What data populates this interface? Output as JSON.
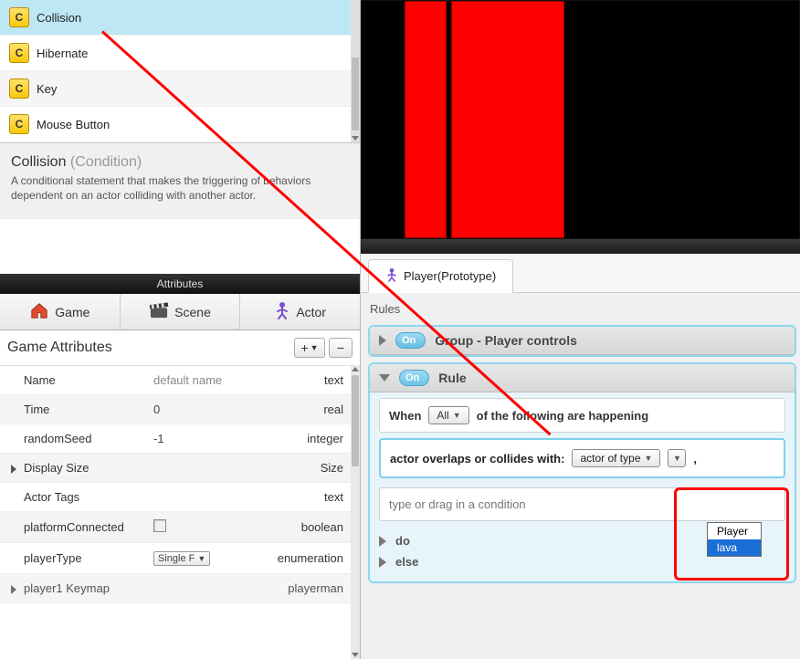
{
  "left": {
    "conditions": [
      {
        "label": "Collision",
        "selected": true
      },
      {
        "label": "Hibernate",
        "selected": false
      },
      {
        "label": "Key",
        "selected": false
      },
      {
        "label": "Mouse Button",
        "selected": false
      }
    ],
    "hint": {
      "name": "Collision",
      "type": "(Condition)",
      "body": "A conditional statement that makes the triggering of behaviors dependent on an actor colliding with another actor."
    },
    "attributes_header": "Attributes",
    "tabs": [
      "Game",
      "Scene",
      "Actor"
    ],
    "section_title": "Game Attributes",
    "table": {
      "headers": {
        "name": "Name",
        "def": "default name",
        "type": "text"
      },
      "rows": [
        {
          "name": "Time",
          "def": "0",
          "type": "real",
          "expandable": false
        },
        {
          "name": "randomSeed",
          "def": "-1",
          "type": "integer",
          "expandable": false
        },
        {
          "name": "Display Size",
          "def": "",
          "type": "Size",
          "expandable": true
        },
        {
          "name": "Actor Tags",
          "def": "",
          "type": "text",
          "expandable": false
        },
        {
          "name": "platformConnected",
          "def": "",
          "type": "boolean",
          "checkbox": true
        },
        {
          "name": "playerType",
          "def": "Single F",
          "type": "enumeration",
          "select": true
        },
        {
          "name": "player1 Keymap",
          "def": "",
          "type": "playerman",
          "expandable": true
        }
      ]
    }
  },
  "right": {
    "prototype_tab": "Player(Prototype)",
    "rules_label": "Rules",
    "group": {
      "pill": "On",
      "title": "Group - Player controls"
    },
    "rule": {
      "pill": "On",
      "title": "Rule",
      "when_label": "When",
      "all_label": "All",
      "when_tail": "of the following are happening",
      "cond_text": "actor overlaps or collides with:",
      "cond_select": "actor of type",
      "comma": ",",
      "dropdown_options": [
        "Player",
        "lava"
      ],
      "placeholder": "type or drag in a condition",
      "do": "do",
      "else": "else"
    }
  }
}
